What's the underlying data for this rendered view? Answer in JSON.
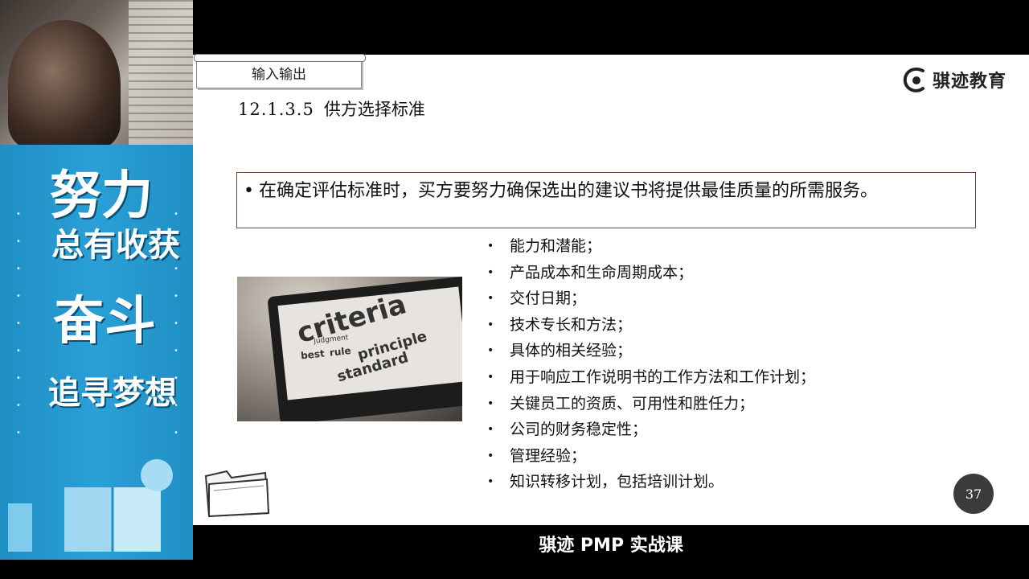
{
  "slide": {
    "tab_label": "输入输出",
    "logo_text": "骐迹教育",
    "heading_number": "12.1.3.5",
    "heading_title": "供方选择标准",
    "box_text": "在确定评估标准时，买方要努力确保选出的建议书将提供最佳质量的所需服务。",
    "criteria": [
      "能力和潜能；",
      "产品成本和生命周期成本；",
      "交付日期；",
      "技术专长和方法；",
      "具体的相关经验；",
      "用于响应工作说明书的工作方法和工作计划；",
      "关键员工的资质、可用性和胜任力；",
      "公司的财务稳定性；",
      "管理经验；",
      "知识转移计划，包括培训计划。"
    ],
    "image_words": [
      "criteria",
      "best",
      "rule",
      "principle",
      "standard",
      "judgment"
    ],
    "page_number": "37"
  },
  "banner": {
    "line1": "努力",
    "line2": "总有收获",
    "line3": "奋斗",
    "line4": "追寻梦想"
  },
  "caption": "骐迹 PMP 实战课",
  "colors": {
    "banner_blue": "#2aa0d6",
    "slide_bg": "#ffffff",
    "page_circle": "#3b3b3b"
  }
}
